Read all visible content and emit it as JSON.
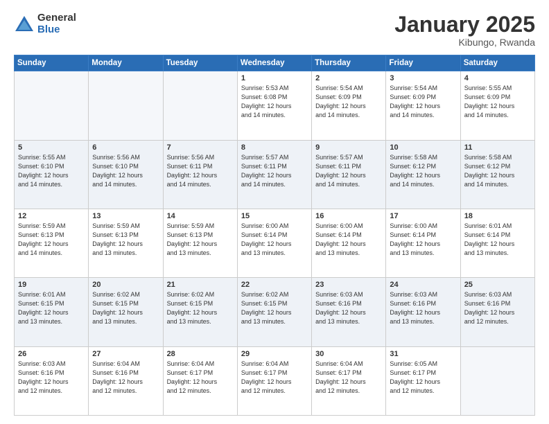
{
  "header": {
    "logo_general": "General",
    "logo_blue": "Blue",
    "month_title": "January 2025",
    "location": "Kibungo, Rwanda"
  },
  "days_of_week": [
    "Sunday",
    "Monday",
    "Tuesday",
    "Wednesday",
    "Thursday",
    "Friday",
    "Saturday"
  ],
  "weeks": [
    [
      {
        "day": "",
        "info": ""
      },
      {
        "day": "",
        "info": ""
      },
      {
        "day": "",
        "info": ""
      },
      {
        "day": "1",
        "info": "Sunrise: 5:53 AM\nSunset: 6:08 PM\nDaylight: 12 hours\nand 14 minutes."
      },
      {
        "day": "2",
        "info": "Sunrise: 5:54 AM\nSunset: 6:09 PM\nDaylight: 12 hours\nand 14 minutes."
      },
      {
        "day": "3",
        "info": "Sunrise: 5:54 AM\nSunset: 6:09 PM\nDaylight: 12 hours\nand 14 minutes."
      },
      {
        "day": "4",
        "info": "Sunrise: 5:55 AM\nSunset: 6:09 PM\nDaylight: 12 hours\nand 14 minutes."
      }
    ],
    [
      {
        "day": "5",
        "info": "Sunrise: 5:55 AM\nSunset: 6:10 PM\nDaylight: 12 hours\nand 14 minutes."
      },
      {
        "day": "6",
        "info": "Sunrise: 5:56 AM\nSunset: 6:10 PM\nDaylight: 12 hours\nand 14 minutes."
      },
      {
        "day": "7",
        "info": "Sunrise: 5:56 AM\nSunset: 6:11 PM\nDaylight: 12 hours\nand 14 minutes."
      },
      {
        "day": "8",
        "info": "Sunrise: 5:57 AM\nSunset: 6:11 PM\nDaylight: 12 hours\nand 14 minutes."
      },
      {
        "day": "9",
        "info": "Sunrise: 5:57 AM\nSunset: 6:11 PM\nDaylight: 12 hours\nand 14 minutes."
      },
      {
        "day": "10",
        "info": "Sunrise: 5:58 AM\nSunset: 6:12 PM\nDaylight: 12 hours\nand 14 minutes."
      },
      {
        "day": "11",
        "info": "Sunrise: 5:58 AM\nSunset: 6:12 PM\nDaylight: 12 hours\nand 14 minutes."
      }
    ],
    [
      {
        "day": "12",
        "info": "Sunrise: 5:59 AM\nSunset: 6:13 PM\nDaylight: 12 hours\nand 14 minutes."
      },
      {
        "day": "13",
        "info": "Sunrise: 5:59 AM\nSunset: 6:13 PM\nDaylight: 12 hours\nand 13 minutes."
      },
      {
        "day": "14",
        "info": "Sunrise: 5:59 AM\nSunset: 6:13 PM\nDaylight: 12 hours\nand 13 minutes."
      },
      {
        "day": "15",
        "info": "Sunrise: 6:00 AM\nSunset: 6:14 PM\nDaylight: 12 hours\nand 13 minutes."
      },
      {
        "day": "16",
        "info": "Sunrise: 6:00 AM\nSunset: 6:14 PM\nDaylight: 12 hours\nand 13 minutes."
      },
      {
        "day": "17",
        "info": "Sunrise: 6:00 AM\nSunset: 6:14 PM\nDaylight: 12 hours\nand 13 minutes."
      },
      {
        "day": "18",
        "info": "Sunrise: 6:01 AM\nSunset: 6:14 PM\nDaylight: 12 hours\nand 13 minutes."
      }
    ],
    [
      {
        "day": "19",
        "info": "Sunrise: 6:01 AM\nSunset: 6:15 PM\nDaylight: 12 hours\nand 13 minutes."
      },
      {
        "day": "20",
        "info": "Sunrise: 6:02 AM\nSunset: 6:15 PM\nDaylight: 12 hours\nand 13 minutes."
      },
      {
        "day": "21",
        "info": "Sunrise: 6:02 AM\nSunset: 6:15 PM\nDaylight: 12 hours\nand 13 minutes."
      },
      {
        "day": "22",
        "info": "Sunrise: 6:02 AM\nSunset: 6:15 PM\nDaylight: 12 hours\nand 13 minutes."
      },
      {
        "day": "23",
        "info": "Sunrise: 6:03 AM\nSunset: 6:16 PM\nDaylight: 12 hours\nand 13 minutes."
      },
      {
        "day": "24",
        "info": "Sunrise: 6:03 AM\nSunset: 6:16 PM\nDaylight: 12 hours\nand 13 minutes."
      },
      {
        "day": "25",
        "info": "Sunrise: 6:03 AM\nSunset: 6:16 PM\nDaylight: 12 hours\nand 12 minutes."
      }
    ],
    [
      {
        "day": "26",
        "info": "Sunrise: 6:03 AM\nSunset: 6:16 PM\nDaylight: 12 hours\nand 12 minutes."
      },
      {
        "day": "27",
        "info": "Sunrise: 6:04 AM\nSunset: 6:16 PM\nDaylight: 12 hours\nand 12 minutes."
      },
      {
        "day": "28",
        "info": "Sunrise: 6:04 AM\nSunset: 6:17 PM\nDaylight: 12 hours\nand 12 minutes."
      },
      {
        "day": "29",
        "info": "Sunrise: 6:04 AM\nSunset: 6:17 PM\nDaylight: 12 hours\nand 12 minutes."
      },
      {
        "day": "30",
        "info": "Sunrise: 6:04 AM\nSunset: 6:17 PM\nDaylight: 12 hours\nand 12 minutes."
      },
      {
        "day": "31",
        "info": "Sunrise: 6:05 AM\nSunset: 6:17 PM\nDaylight: 12 hours\nand 12 minutes."
      },
      {
        "day": "",
        "info": ""
      }
    ]
  ]
}
